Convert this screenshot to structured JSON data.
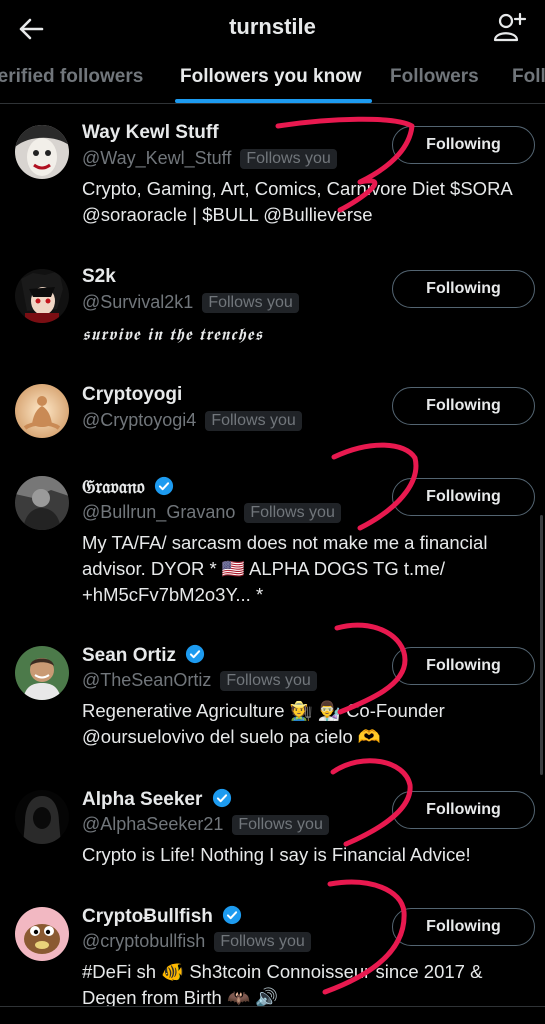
{
  "header": {
    "title": "turnstile"
  },
  "tabs": [
    {
      "label": "Verified followers",
      "active": false
    },
    {
      "label": "Followers you know",
      "active": true
    },
    {
      "label": "Followers",
      "active": false
    },
    {
      "label": "Following",
      "active": false
    }
  ],
  "users": [
    {
      "name": "Way Kewl Stuff",
      "handle": "@Way_Kewl_Stuff",
      "badge": "Follows you",
      "verified": false,
      "bio": "Crypto, Gaming, Art, Comics, Carnivore Diet $SORA @soraoracle | $BULL @Bullieverse",
      "button": "Following",
      "avatar": "clown-face"
    },
    {
      "name": "S2k",
      "handle": "@Survival2k1",
      "badge": "Follows you",
      "verified": false,
      "bio": "𝖘𝖚𝖗𝖛𝖎𝖛𝖊 𝖎𝖓 𝖙𝖍𝖊 𝖙𝖗𝖊𝖓𝖈𝖍𝖊𝖘",
      "button": "Following",
      "avatar": "anime-character"
    },
    {
      "name": "Cryptoyogi",
      "handle": "@Cryptoyogi4",
      "badge": "Follows you",
      "verified": false,
      "bio": "",
      "button": "Following",
      "avatar": "meditating-figure"
    },
    {
      "name": "𝔊𝔯𝔞𝔳𝔞𝔫𝔬",
      "handle": "@Bullrun_Gravano",
      "badge": "Follows you",
      "verified": true,
      "bio": "My TA/FA/ sarcasm does not make me a financial advisor. DYOR * 🇺🇸 ALPHA DOGS TG t.me/ +hM5cFv7bM2o3Y... *",
      "button": "Following",
      "avatar": "grayscale-man"
    },
    {
      "name": "Sean Ortiz",
      "handle": "@TheSeanOrtiz",
      "badge": "Follows you",
      "verified": true,
      "bio": "Regenerative Agriculture 🧑‍🌾 👨‍🔬 Co-Founder @oursuelovivo del suelo pa cielo 🫶",
      "button": "Following",
      "avatar": "smiling-man"
    },
    {
      "name": "Alpha Seeker",
      "handle": "@AlphaSeeker21",
      "badge": "Follows you",
      "verified": true,
      "bio": "Crypto is Life! Nothing I say is Financial Advice!",
      "button": "Following",
      "avatar": "hooded-figure"
    },
    {
      "name": "CryptoɃullfish",
      "handle": "@cryptobullfish",
      "badge": "Follows you",
      "verified": true,
      "bio": "#DeFi sh 🐠 Sh3tcoin Connoisseur since 2017 & Degen from Birth 🦇 🔊",
      "button": "Following",
      "avatar": "cartoon-fish"
    }
  ],
  "colors": {
    "background": "#000000",
    "accent": "#1d9bf0",
    "muted": "#71767b",
    "annotation": "#e8194f"
  }
}
